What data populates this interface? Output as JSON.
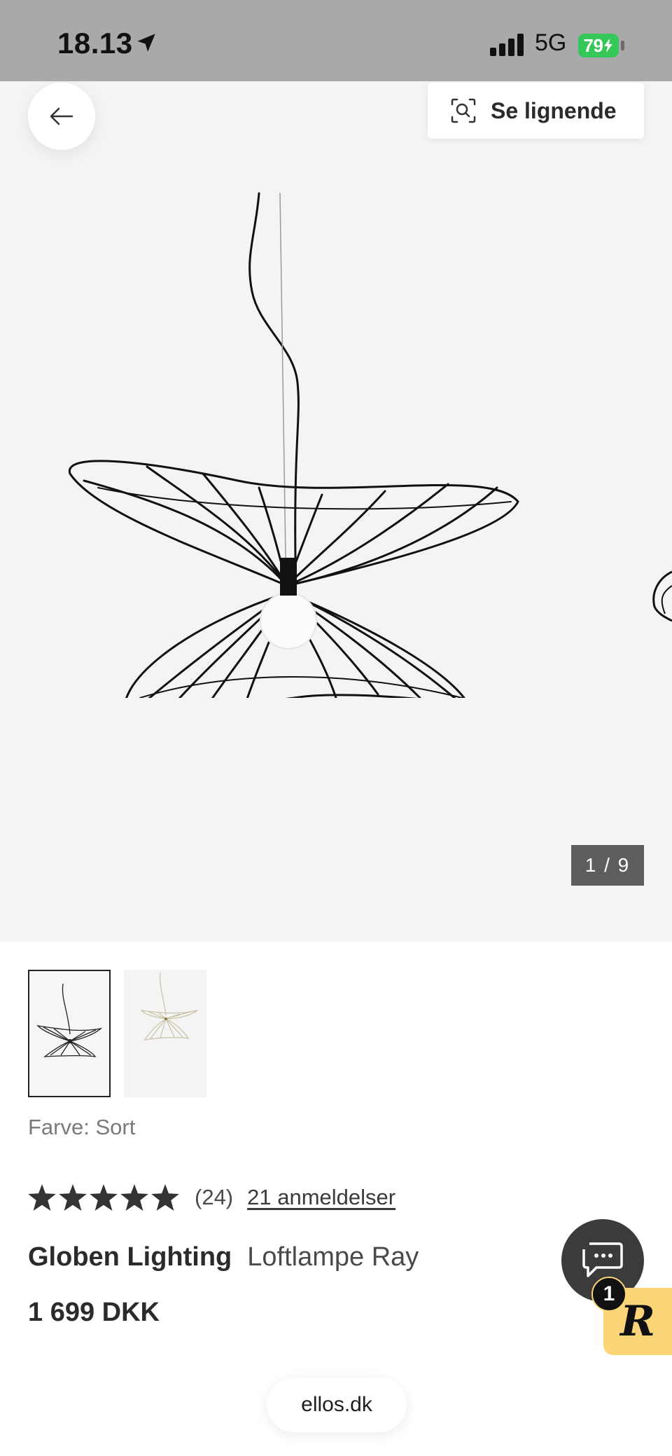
{
  "status_bar": {
    "time": "18.13",
    "network": "5G",
    "battery": "79"
  },
  "hero": {
    "similar_button": "Se lignende",
    "counter": "1 / 9"
  },
  "product": {
    "color_label": "Farve: Sort",
    "rating_value": 5,
    "rating_count": "(24)",
    "reviews_link": "21 anmeldelser",
    "brand": "Globen Lighting",
    "name": "Loftlampe Ray",
    "price": "1 699 DKK"
  },
  "chat": {
    "badge_count": "1",
    "brand_badge": "R"
  },
  "browser": {
    "url": "ellos.dk"
  },
  "colors": {
    "status_bar_bg": "#a9a9a9",
    "battery_green": "#36c759",
    "hero_bg": "#f4f4f4",
    "chat_bg": "#3b3b3b",
    "badge_yellow": "#fbd577"
  }
}
